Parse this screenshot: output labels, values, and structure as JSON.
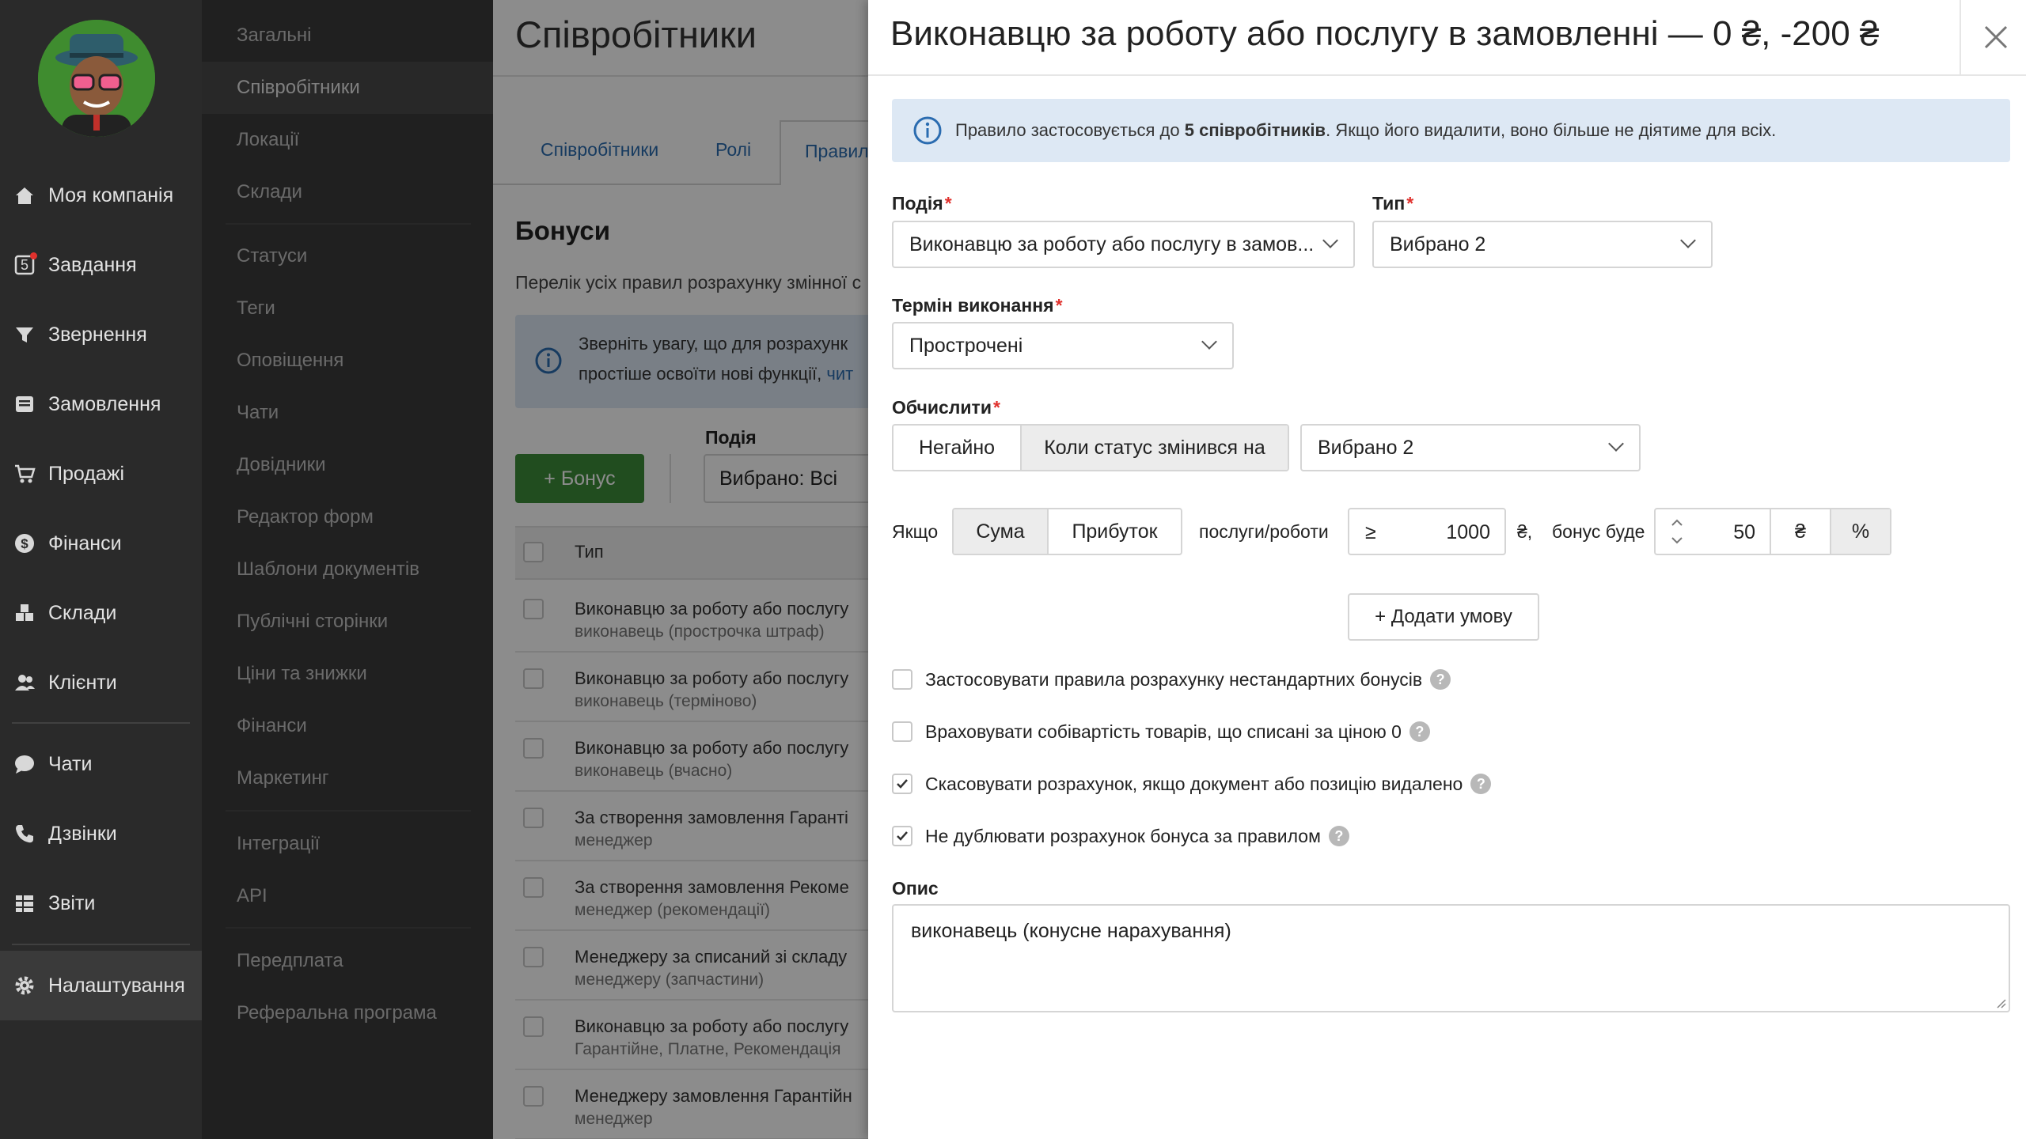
{
  "nav": {
    "items": [
      {
        "label": "Моя компанія",
        "icon": "home-icon"
      },
      {
        "label": "Завдання",
        "icon": "tasks-icon",
        "badge": "5"
      },
      {
        "label": "Звернення",
        "icon": "funnel-icon"
      },
      {
        "label": "Замовлення",
        "icon": "orders-icon"
      },
      {
        "label": "Продажі",
        "icon": "cart-icon"
      },
      {
        "label": "Фінанси",
        "icon": "dollar-icon"
      },
      {
        "label": "Склади",
        "icon": "warehouse-icon"
      },
      {
        "label": "Клієнти",
        "icon": "clients-icon"
      },
      {
        "label": "Чати",
        "icon": "chat-icon"
      },
      {
        "label": "Дзвінки",
        "icon": "phone-icon"
      },
      {
        "label": "Звіти",
        "icon": "reports-icon"
      },
      {
        "label": "Налаштування",
        "icon": "gear-icon"
      }
    ]
  },
  "settings": {
    "items": [
      "Загальні",
      "Співробітники",
      "Локації",
      "Склади",
      "Статуси",
      "Теги",
      "Оповіщення",
      "Чати",
      "Довідники",
      "Редактор форм",
      "Шаблони документів",
      "Публічні сторінки",
      "Ціни та знижки",
      "Фінанси",
      "Маркетинг",
      "Інтеграції",
      "API",
      "Передплата",
      "Реферальна програма"
    ]
  },
  "page": {
    "title": "Співробітники",
    "tabs": [
      "Співробітники",
      "Ролі",
      "Правил"
    ],
    "section_title": "Бонуси",
    "section_desc": "Перелік усіх правил розрахунку змінної с",
    "notice_line1": "Зверніть увагу, що для розрахунк",
    "notice_line2": "простіше освоїти нові функції,",
    "notice_link": "чит",
    "add_button": "+ Бонус",
    "filter_label": "Подія",
    "filter_value": "Вибрано: Всі",
    "table_header": "Тип",
    "rows": [
      {
        "title": "Виконавцю за роботу або послугу",
        "sub": "виконавець (прострочка штраф)"
      },
      {
        "title": "Виконавцю за роботу або послугу",
        "sub": "виконавець (терміново)"
      },
      {
        "title": "Виконавцю за роботу або послугу",
        "sub": "виконавець (вчасно)"
      },
      {
        "title": "За створення замовлення Гаранті",
        "sub": "менеджер"
      },
      {
        "title": "За створення замовлення Рекоме",
        "sub": "менеджер (рекомендації)"
      },
      {
        "title": "Менеджеру за списаний зі складу",
        "sub": "менеджеру (запчастини)"
      },
      {
        "title": "Виконавцю за роботу або послугу",
        "sub": "Гарантійне, Платне, Рекомендація"
      },
      {
        "title": "Менеджеру замовлення Гарантійн",
        "sub": "менеджер"
      }
    ]
  },
  "drawer": {
    "title": "Виконавцю за роботу або послугу в замовленні — 0 ₴, -200 ₴",
    "info_pre": "Правило застосовується до ",
    "info_bold": "5 співробітників",
    "info_post": ". Якщо його видалити, воно більше не діятиме для всіх.",
    "event_label": "Подія",
    "event_value": "Виконавцю за роботу або послугу в замов...",
    "type_label": "Тип",
    "type_value": "Вибрано 2",
    "term_label": "Термін виконання",
    "term_value": "Прострочені",
    "calc_label": "Обчислити",
    "calc_options": [
      "Негайно",
      "Коли статус змінився на"
    ],
    "calc_selected": 1,
    "status_value": "Вибрано 2",
    "if_label": "Якщо",
    "sum_options": [
      "Сума",
      "Прибуток"
    ],
    "sum_selected": 0,
    "service_label": "послуги/роботи",
    "op": "≥",
    "amount": "1000",
    "currency_after": "₴,",
    "bonus_label": "бонус буде",
    "bonus_value": "50",
    "unit_options": [
      "₴",
      "%"
    ],
    "unit_selected": 1,
    "add_condition": "+ Додати умову",
    "checkboxes": [
      {
        "label": "Застосовувати правила розрахунку нестандартних бонусів",
        "checked": false
      },
      {
        "label": "Враховувати собівартість товарів, що списані за ціною 0",
        "checked": false
      },
      {
        "label": "Скасовувати розрахунок, якщо документ або позицію видалено",
        "checked": true
      },
      {
        "label": "Не дублювати розрахунок бонуса за правилом",
        "checked": true
      }
    ],
    "desc_label": "Опис",
    "desc_value": "виконавець (конусне нарахування)"
  }
}
